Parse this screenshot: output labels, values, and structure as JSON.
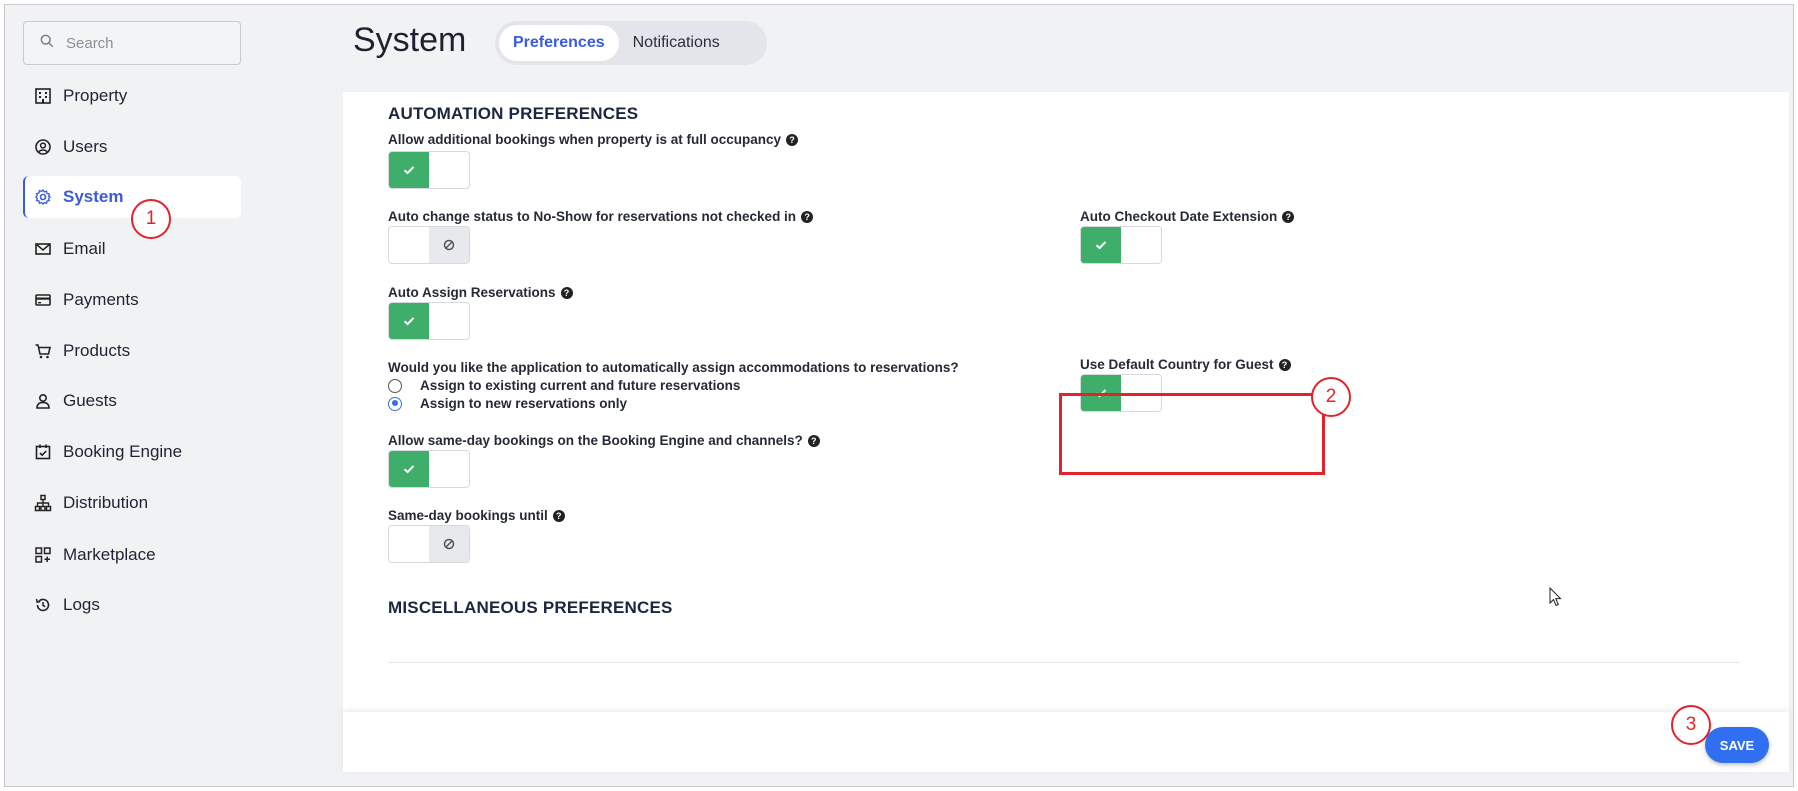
{
  "search": {
    "placeholder": "Search"
  },
  "sidebar": {
    "items": [
      {
        "label": "Property",
        "icon": "building-icon"
      },
      {
        "label": "Users",
        "icon": "user-circle-icon"
      },
      {
        "label": "System",
        "icon": "gear-icon",
        "active": true
      },
      {
        "label": "Email",
        "icon": "mail-icon"
      },
      {
        "label": "Payments",
        "icon": "credit-card-icon"
      },
      {
        "label": "Products",
        "icon": "cart-icon"
      },
      {
        "label": "Guests",
        "icon": "person-icon"
      },
      {
        "label": "Booking Engine",
        "icon": "calendar-check-icon"
      },
      {
        "label": "Distribution",
        "icon": "hierarchy-icon"
      },
      {
        "label": "Marketplace",
        "icon": "grid-plus-icon"
      },
      {
        "label": "Logs",
        "icon": "history-icon"
      }
    ]
  },
  "header": {
    "title": "System",
    "tabs": [
      {
        "label": "Preferences",
        "active": true
      },
      {
        "label": "Notifications",
        "active": false
      }
    ]
  },
  "automation": {
    "title": "AUTOMATION PREFERENCES",
    "allow_additional": {
      "label": "Allow additional bookings when property is at full occupancy",
      "on": true
    },
    "auto_noshow": {
      "label": "Auto change status to No-Show for reservations not checked in",
      "on": false
    },
    "auto_checkout": {
      "label": "Auto Checkout Date Extension",
      "on": true
    },
    "auto_assign": {
      "label": "Auto Assign Reservations",
      "on": true
    },
    "assign_question": "Would you like the application to automatically assign accommodations to reservations?",
    "assign_options": [
      {
        "label": "Assign to existing current and future reservations",
        "selected": false
      },
      {
        "label": "Assign to new reservations only",
        "selected": true
      }
    ],
    "default_country": {
      "label": "Use Default Country for Guest",
      "on": true
    },
    "same_day": {
      "label": "Allow same-day bookings on the Booking Engine and channels?",
      "on": true
    },
    "same_day_until": {
      "label": "Same-day bookings until",
      "on": false
    }
  },
  "misc": {
    "title": "MISCELLANEOUS PREFERENCES"
  },
  "footer": {
    "save_label": "SAVE"
  },
  "annotations": [
    "1",
    "2",
    "3"
  ],
  "colors": {
    "accent": "#3b5bdb",
    "toggle_on": "#3fae6a",
    "save": "#2f6ff0",
    "annotation": "#e0242a"
  }
}
